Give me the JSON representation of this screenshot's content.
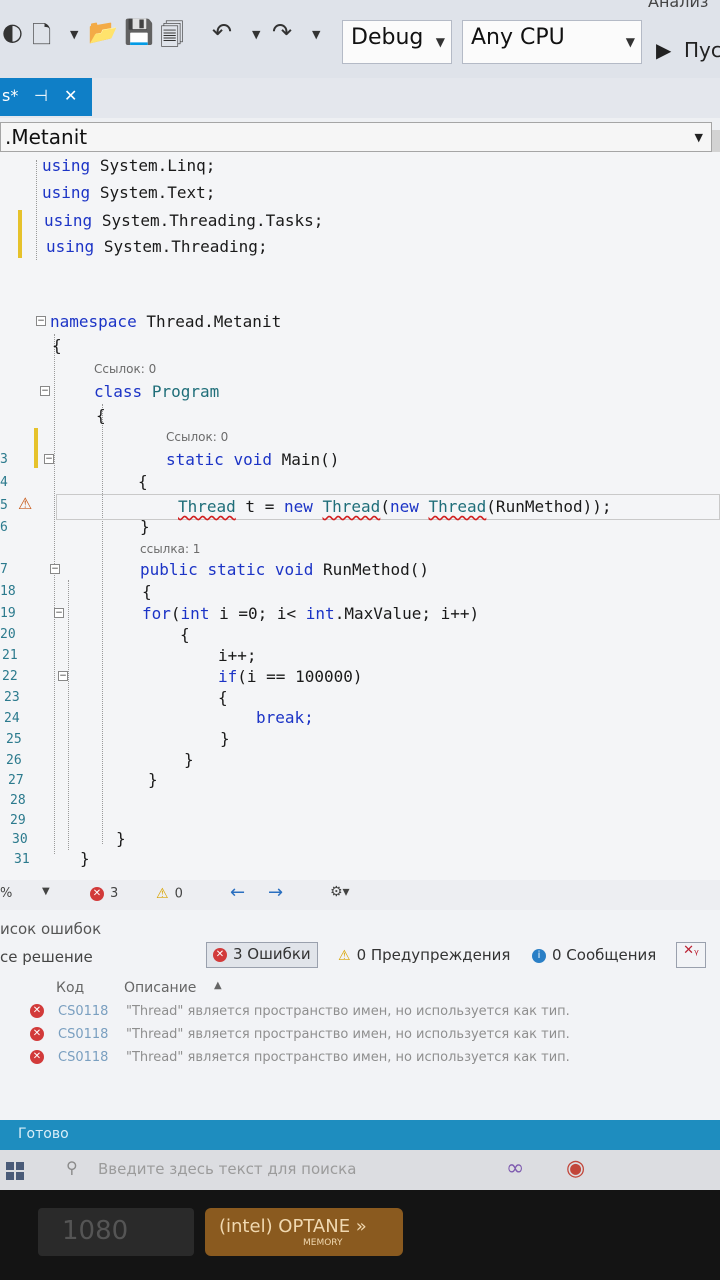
{
  "toolbar": {
    "config": "Debug",
    "platform": "Any CPU",
    "run_label": "Пус",
    "top_text": "Анализ"
  },
  "tab": {
    "name": "s*",
    "pin": "⊣",
    "close": "✕"
  },
  "navbar": {
    "namespace": ".Metanit"
  },
  "code": {
    "using_linq": "System.Linq;",
    "using_text": "System.Text;",
    "using_tasks": "System.Threading.Tasks;",
    "using_threading": "System.Threading;",
    "ns_name": "Thread.Metanit",
    "class_name": "Program",
    "refs_class": "Ссылок: 0",
    "refs_main": "Ссылок: 0",
    "refs_run": "ссылка: 1",
    "main_sig": "Main()",
    "run_sig": "RunMethod()",
    "line_thread_1": "Thread",
    "line_thread_2": " t = ",
    "line_thread_3": "Thread",
    "line_thread_4": "Thread",
    "line_thread_5": "(RunMethod));",
    "for_1": "(",
    "for_2": " i =0; i< ",
    "for_3": ".MaxValue; i++)",
    "inc": "i++;",
    "if_1": "(i == 100000)",
    "brk": "break;"
  },
  "line_numbers": [
    "3",
    "4",
    "5",
    "6",
    "7",
    "18",
    "19",
    "20",
    "21",
    "22",
    "23",
    "24",
    "25",
    "26",
    "27",
    "28",
    "29",
    "30",
    "31"
  ],
  "strip": {
    "zoom": "%",
    "errors": "3",
    "warnings": "0"
  },
  "errors_panel": {
    "title": "исок ошибок",
    "scope": "се решение",
    "errors_filter": "3 Ошибки",
    "warnings_filter": "0 Предупреждения",
    "messages_filter": "0 Сообщения",
    "col_code": "Код",
    "col_desc": "Описание",
    "rows": [
      {
        "code": "CS0118",
        "desc": "\"Thread\" является пространство имен, но используется как тип."
      },
      {
        "code": "CS0118",
        "desc": "\"Thread\" является пространство имен, но используется как тип."
      },
      {
        "code": "CS0118",
        "desc": "\"Thread\" является пространство имен, но используется как тип."
      }
    ]
  },
  "status": {
    "text": "Готово"
  },
  "taskbar": {
    "search_placeholder": "Введите здесь текст для поиска"
  },
  "bezel": {
    "brand": "(intel) OPTANE »",
    "sub": "MEMORY",
    "left": "1080"
  }
}
